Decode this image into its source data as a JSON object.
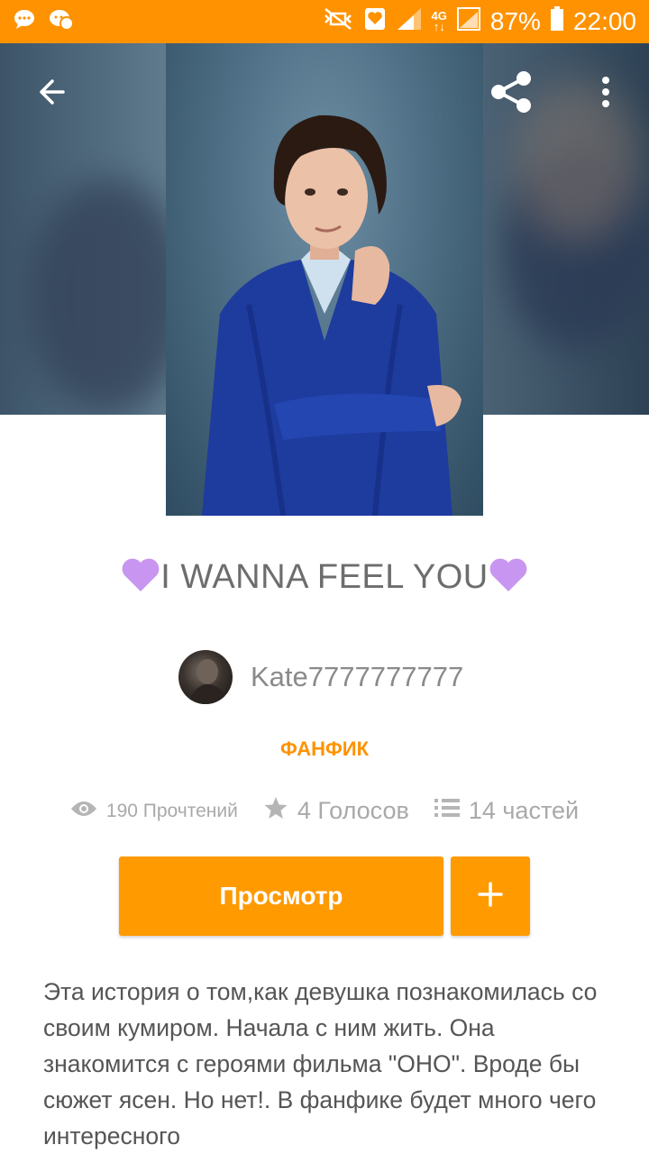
{
  "status_bar": {
    "battery": "87%",
    "time": "22:00",
    "network": "4G"
  },
  "story": {
    "title_emoji_left": "💜",
    "title": "I WANNA FEEL YOU",
    "title_emoji_right": "💜",
    "author": "Kate7777777777",
    "category": "ФАНФИК",
    "reads": "190 Прочтений",
    "votes": "4 Голосов",
    "parts": "14 частей",
    "read_button": "Просмотр",
    "add_button": "+",
    "description": "Эта история о том,как девушка познакомилась со своим кумиром. Начала с ним жить. Она знакомится с героями фильма \"ОНО\". Вроде бы сюжет ясен. Но нет!. В фанфике будет много чего интересного"
  },
  "colors": {
    "accent": "#ff9200",
    "status_bar": "#ff9200",
    "text_primary": "#555555",
    "text_muted": "#a9a9a9"
  },
  "icons": [
    "chat-icon",
    "game-icon",
    "mute-icon",
    "heart-box-icon",
    "signal-icon",
    "battery-icon",
    "back-arrow-icon",
    "share-icon",
    "more-vert-icon",
    "eye-icon",
    "star-icon",
    "list-icon",
    "plus-icon"
  ]
}
